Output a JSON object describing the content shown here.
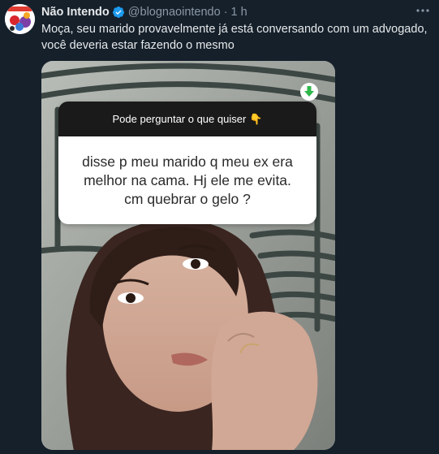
{
  "tweet": {
    "author_name": "Não Intendo",
    "handle": "@blognaointendo",
    "separator": "·",
    "time": "1 h",
    "text_line1": "Moça, seu marido provavelmente já está conversando com um advogado,",
    "text_line2": "você deveria estar fazendo o mesmo"
  },
  "media": {
    "question_header": "Pode perguntar o que quiser",
    "header_emoji": "👇",
    "question_line1": "disse p meu marido q meu ex era",
    "question_line2": "melhor na cama. Hj ele me evita.",
    "question_line3": "cm quebrar o gelo ?"
  },
  "colors": {
    "background": "#15202b",
    "verified": "#1d9bf0",
    "secondary_text": "#8b98a5",
    "download_badge": "#2fb84a"
  },
  "icons": [
    "verified-badge-icon",
    "more-options-icon",
    "download-arrow-icon",
    "pointing-down-emoji-icon"
  ]
}
